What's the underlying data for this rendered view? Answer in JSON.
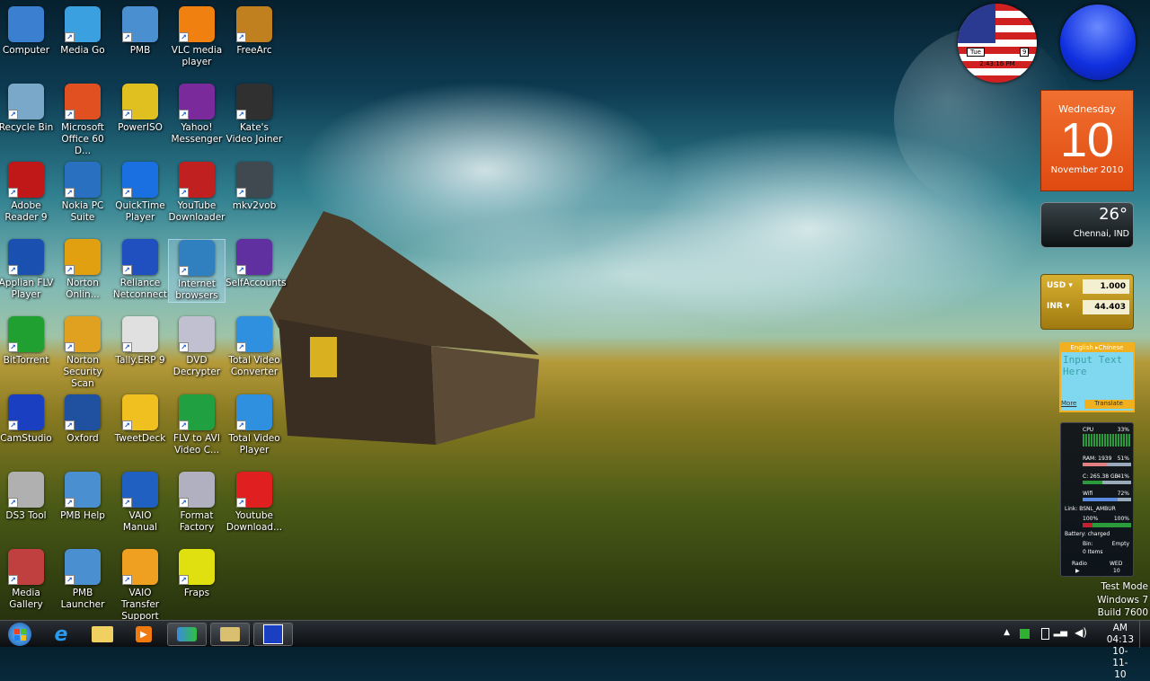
{
  "desktop_icons": [
    [
      "Computer",
      "Media Go",
      "PMB",
      "VLC media player",
      "FreeArc"
    ],
    [
      "Recycle Bin",
      "Microsoft Office 60 D...",
      "PowerISO",
      "Yahoo! Messenger",
      "Kate's Video Joiner"
    ],
    [
      "Adobe Reader 9",
      "Nokia PC Suite",
      "QuickTime Player",
      "YouTube Downloader",
      "mkv2vob"
    ],
    [
      "Applian FLV Player",
      "Norton Onlin...",
      "Reliance Netconnect",
      "Internet browsers",
      "SelfAccounts"
    ],
    [
      "BitTorrent",
      "Norton Security Scan",
      "Tally.ERP 9",
      "DVD Decrypter",
      "Total Video Converter"
    ],
    [
      "CamStudio",
      "Oxford",
      "TweetDeck",
      "FLV to AVI Video C...",
      "Total Video Player"
    ],
    [
      "DS3 Tool",
      "PMB Help",
      "VAIO Manual",
      "Format Factory",
      "Youtube Download..."
    ],
    [
      "Media Gallery",
      "PMB Launcher",
      "VAIO Transfer Support",
      "Fraps"
    ]
  ],
  "icon_colors": [
    [
      "#3a7fd0",
      "#3aa0e0",
      "#4a8fd0",
      "#f08010",
      "#c08020"
    ],
    [
      "#7aa8c8",
      "#e05020",
      "#e0c020",
      "#7a2a9a",
      "#303030"
    ],
    [
      "#c01818",
      "#2a70c0",
      "#1a70e0",
      "#c02020",
      "#404850"
    ],
    [
      "#1a50b0",
      "#e0a010",
      "#2050c0",
      "#3080c0",
      "#6030a0"
    ],
    [
      "#20a030",
      "#e0a020",
      "#e0e0e0",
      "#c0c0d0",
      "#3090e0"
    ],
    [
      "#1a3fc0",
      "#2050a0",
      "#f0c020",
      "#20a040",
      "#3090e0"
    ],
    [
      "#b0b0b0",
      "#4a8fd0",
      "#2060c0",
      "#b0b0c0",
      "#e02020"
    ],
    [
      "#c04040",
      "#4a8fd0",
      "#f0a020",
      "#e0e010"
    ]
  ],
  "selected_icon": "Internet browsers",
  "gadgets": {
    "flag_clock": {
      "day": "Tue",
      "date": "9",
      "time": "2:43:16 PM"
    },
    "calendar": {
      "weekday": "Wednesday",
      "day": "10",
      "month_year": "November 2010"
    },
    "weather": {
      "temp": "26°",
      "location": "Chennai, IND"
    },
    "currency": {
      "from": "USD",
      "from_value": "1.000",
      "to": "INR",
      "to_value": "44.403"
    },
    "translator": {
      "langs": "English ▸Chinese",
      "placeholder": "Input Text Here",
      "more": "More",
      "translate": "Translate"
    },
    "monitor": {
      "cpu_label": "CPU",
      "cpu": "33%",
      "ram_label": "RAM: 1939",
      "ram": "51%",
      "disk_label": "C: 265.38 GB",
      "disk": "41%",
      "wifi_label": "Wifi",
      "wifi": "72%",
      "link": "Link: BSNL_AMBUR",
      "bat1": "100%",
      "bat2": "100%",
      "battery": "Battery: charged",
      "bin_label": "Bin:",
      "bin_items": "0 Items",
      "bin_state": "Empty",
      "radio": "Radio",
      "dow": "WED",
      "dom": "10"
    }
  },
  "watermark": [
    "Test Mode",
    "Windows 7",
    "Build 7600"
  ],
  "taskbar": {
    "clock_time": "AM 04:13",
    "clock_date": "10-11-10"
  }
}
